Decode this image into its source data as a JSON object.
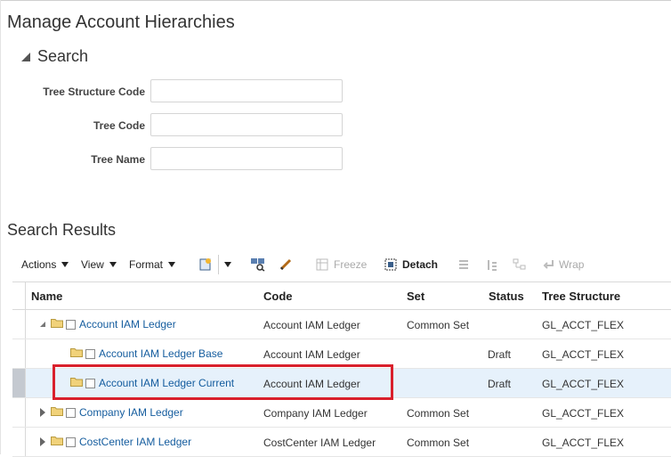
{
  "page": {
    "title": "Manage Account Hierarchies"
  },
  "search": {
    "title": "Search",
    "fields": [
      {
        "label": "Tree Structure Code",
        "value": ""
      },
      {
        "label": "Tree Code",
        "value": ""
      },
      {
        "label": "Tree Name",
        "value": ""
      }
    ]
  },
  "results": {
    "title": "Search Results",
    "toolbar": {
      "actions": "Actions",
      "view": "View",
      "format": "Format",
      "freeze": "Freeze",
      "detach": "Detach",
      "wrap": "Wrap"
    },
    "columns": [
      "Name",
      "Code",
      "Set",
      "Status",
      "Tree Structure"
    ],
    "rows": [
      {
        "name": "Account IAM Ledger",
        "code": "Account IAM Ledger",
        "set": "Common Set",
        "status": "",
        "tree_structure": "GL_ACCT_FLEX",
        "level": 0,
        "expander": "expanded",
        "selected": false
      },
      {
        "name": "Account IAM Ledger Base",
        "code": "Account IAM Ledger",
        "set": "",
        "status": "Draft",
        "tree_structure": "GL_ACCT_FLEX",
        "level": 1,
        "expander": "none",
        "selected": false
      },
      {
        "name": "Account IAM Ledger Current",
        "code": "Account IAM Ledger",
        "set": "",
        "status": "Draft",
        "tree_structure": "GL_ACCT_FLEX",
        "level": 1,
        "expander": "none",
        "selected": true
      },
      {
        "name": "Company IAM Ledger",
        "code": "Company IAM Ledger",
        "set": "Common Set",
        "status": "",
        "tree_structure": "GL_ACCT_FLEX",
        "level": 0,
        "expander": "collapsed",
        "selected": false
      },
      {
        "name": "CostCenter IAM Ledger",
        "code": "CostCenter IAM Ledger",
        "set": "Common Set",
        "status": "",
        "tree_structure": "GL_ACCT_FLEX",
        "level": 0,
        "expander": "collapsed",
        "selected": false
      }
    ]
  },
  "colors": {
    "link": "#145c9e",
    "highlight_box": "#d9202c",
    "selected_row": "#e6f1fb"
  }
}
